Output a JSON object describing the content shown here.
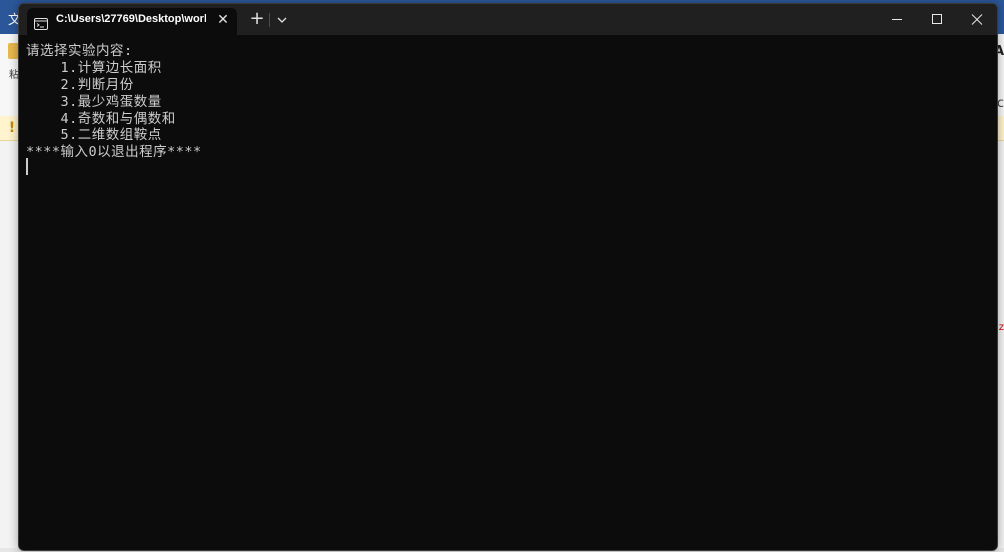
{
  "background_app": {
    "topbar_text": "文",
    "ribbon_label": "粘",
    "right_glyph_a": "A",
    "right_glyph_c": "c",
    "right_glyph_z": "z"
  },
  "terminal": {
    "tab": {
      "title": "C:\\Users\\27769\\Desktop\\worl",
      "icon": "terminal-icon",
      "close_glyph": "✕"
    },
    "new_tab_glyph": "+",
    "window_controls": {
      "minimize": "—",
      "maximize": "☐",
      "close": "✕"
    },
    "console_lines": [
      "请选择实验内容:",
      "    1.计算边长面积",
      "    2.判断月份",
      "    3.最少鸡蛋数量",
      "    4.奇数和与偶数和",
      "    5.二维数组鞍点",
      "****输入0以退出程序****"
    ]
  },
  "colors": {
    "console_bg": "#0c0c0c",
    "titlebar_bg": "#202020",
    "console_text": "#cccccc",
    "accent": "#2b579a"
  }
}
